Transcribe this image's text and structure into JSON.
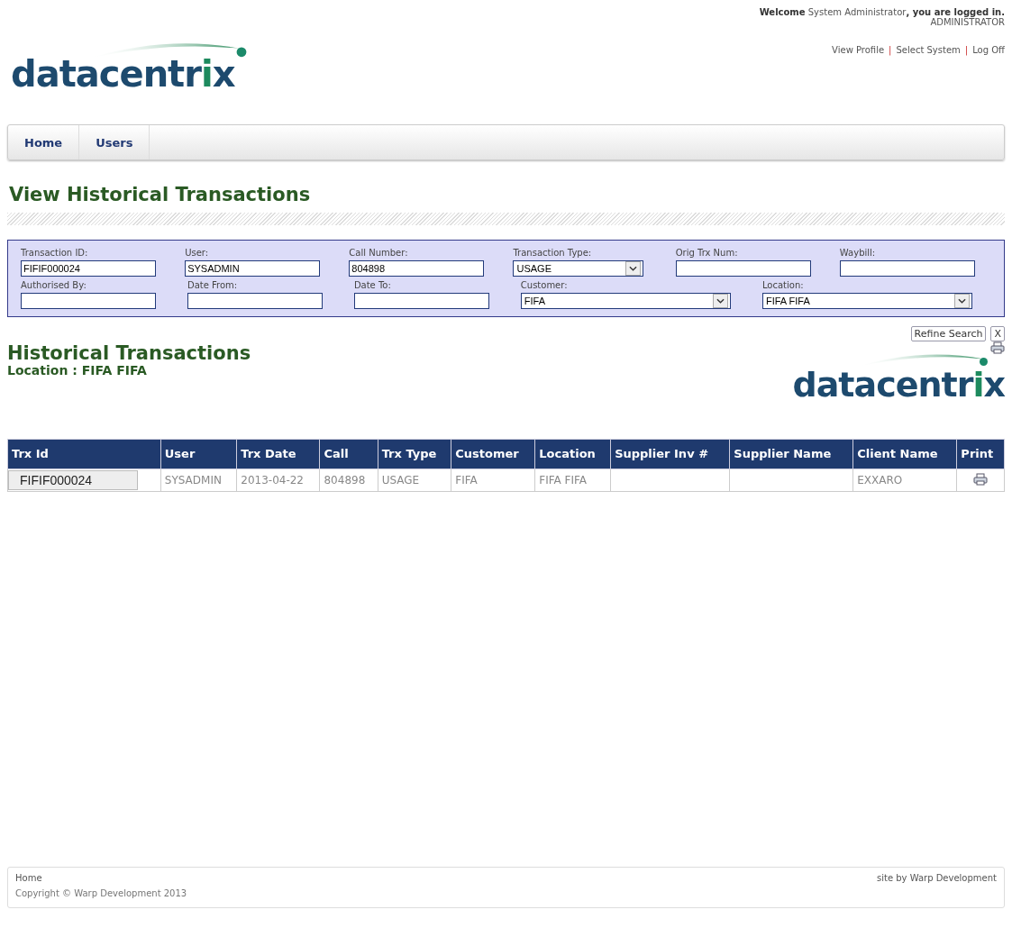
{
  "header": {
    "welcome": "**Welcome** System Administrator**, you are logged in.**",
    "role": "ADMINISTRATOR",
    "links": [
      "View Profile",
      "Select System",
      "Log Off"
    ],
    "link_separator": "|",
    "logo": "datacentrix"
  },
  "nav": [
    "Home",
    "Users"
  ],
  "page_title": "View Historical Transactions",
  "filters": [
    [
      {
        "label": "Transaction ID:",
        "kind": "text",
        "value": "FIFIF000024"
      },
      {
        "label": "User:",
        "kind": "text",
        "value": "SYSADMIN"
      },
      {
        "label": "Call Number:",
        "kind": "text",
        "value": "804898"
      },
      {
        "label": "Transaction Type:",
        "kind": "select",
        "value": "USAGE"
      },
      {
        "label": "Orig Trx Num:",
        "kind": "text"
      },
      {
        "label": "Waybill:",
        "kind": "text"
      }
    ],
    [
      {
        "label": "Authorised By:",
        "kind": "text"
      },
      {
        "label": "Date From:",
        "kind": "text"
      },
      {
        "label": "Date To:",
        "kind": "text"
      },
      {
        "label": "Customer:",
        "kind": "select",
        "value": "FIFA"
      },
      {
        "label": "Location:",
        "kind": "select",
        "value": "FIFA FIFA"
      }
    ]
  ],
  "search_buttons": [
    "Refine Search",
    "X"
  ],
  "results": {
    "title": "Historical Transactions",
    "subtitle": "Location : FIFA FIFA",
    "logo": "datacentrix"
  },
  "table": {
    "columns": [
      "Trx Id",
      "User",
      "Trx Date",
      "Call",
      "Trx Type",
      "Customer",
      "Location",
      "Supplier Inv #",
      "Supplier Name",
      "Client Name",
      "Print"
    ],
    "rows": [
      {
        "cells": [
          "FIFIF000024",
          "SYSADMIN",
          "2013-04-22",
          "804898",
          "USAGE",
          "FIFA",
          "FIFA FIFA",
          "",
          "",
          "EXXARO"
        ]
      }
    ]
  },
  "footer": {
    "links": [
      "Home"
    ],
    "copyright": "Copyright © Warp Development 2013",
    "credit": "site by Warp Development"
  }
}
